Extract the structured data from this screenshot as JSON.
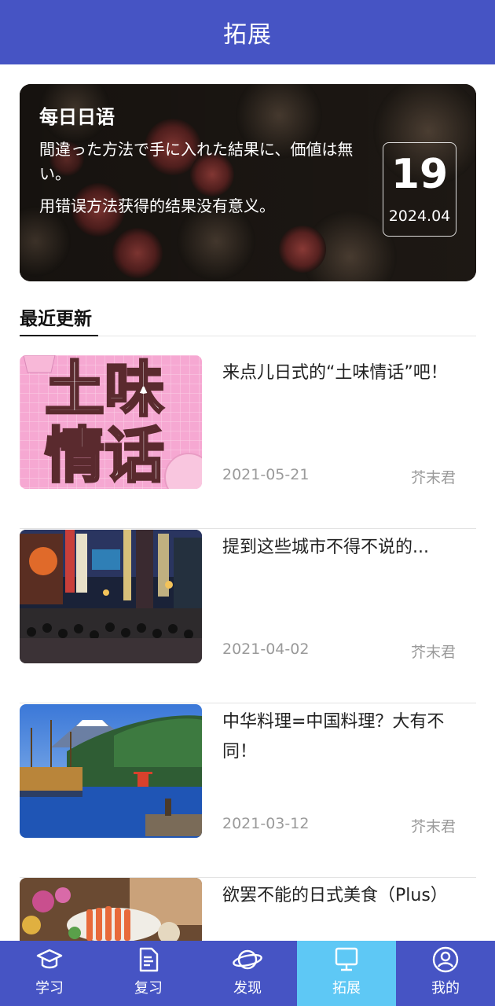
{
  "header": {
    "title": "拓展"
  },
  "daily": {
    "title": "每日日语",
    "japanese": "間違った方法で手に入れた結果に、価値は無い。",
    "chinese": "用错误方法获得的结果没有意义。",
    "day": "19",
    "year_month": "2024.04"
  },
  "section": {
    "title": "最近更新"
  },
  "articles": [
    {
      "title": "来点儿日式的“土味情话”吧！",
      "date": "2021-05-21",
      "author": "芥末君",
      "thumb_text_1": "土味",
      "thumb_text_2": "情话"
    },
    {
      "title": "提到这些城市不得不说的...",
      "date": "2021-04-02",
      "author": "芥末君"
    },
    {
      "title": "中华料理=中国料理？大有不同！",
      "date": "2021-03-12",
      "author": "芥末君"
    },
    {
      "title": "欲罢不能的日式美食（Plus）",
      "date": "",
      "author": ""
    }
  ],
  "tabbar": {
    "active": "拓展",
    "items": [
      {
        "label": "学习",
        "icon": "graduation-cap-icon"
      },
      {
        "label": "复习",
        "icon": "document-icon"
      },
      {
        "label": "发现",
        "icon": "planet-icon"
      },
      {
        "label": "拓展",
        "icon": "monitor-icon"
      },
      {
        "label": "我的",
        "icon": "user-circle-icon"
      }
    ]
  },
  "colors": {
    "primary": "#4654c4",
    "active_tab": "#5ec8f5",
    "meta_text": "#9a9a9a"
  }
}
